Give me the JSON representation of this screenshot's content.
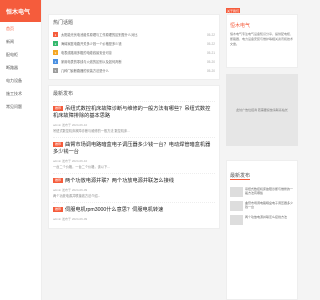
{
  "brand": "恒木电气",
  "nav": [
    "首页",
    "新闻",
    "配电柜",
    "断路器",
    "电力设备",
    "施工技术",
    "常见问题"
  ],
  "hot": {
    "title": "热门话题",
    "items": [
      {
        "text": "太阳能光伏电池组件原理与工作原理的区别是什么对比",
        "date": "05-22"
      },
      {
        "text": "海绵家庭电路开关多少钱一个价格是多少钱",
        "date": "05-22"
      },
      {
        "text": "电表线路用多粗的电缆线最安全可靠",
        "date": "05-21"
      },
      {
        "text": "家用电表的零线与火线的区别以及如何判断",
        "date": "05-20"
      },
      {
        "text": "几种门窗断路器的安装方法是什么",
        "date": "05-20"
      }
    ]
  },
  "latest": {
    "title": "最新发布",
    "articles": [
      {
        "tag": "推荐",
        "title": "吊纽式数控机床故障诊断与维修的一般方法有哪些？吊纽式数控机床故障排除的基本思路",
        "meta": "admin 发布于 2024-06-10",
        "desc": "吊纽式数控机床故障诊断与维修的一般方法 数控机床..."
      },
      {
        "tag": "推荐",
        "title": "曲臂市场调电路暗盒电子调压器多少钱一台？电动焊管暗盒机器多少钱一台",
        "meta": "admin 发布于 2024-06-10",
        "desc": "一台二个价格，一台二个价格，该以下..."
      },
      {
        "tag": "推荐",
        "title": "两个功放电源并联？两个功放电源并联怎么接线",
        "meta": "admin 发布于 2024-06-09",
        "desc": "两个功放电源并联接线方法介绍..."
      },
      {
        "tag": "推荐",
        "title": "伺服电机rpm3000什么意思？伺服电机转速",
        "meta": "admin 发布于 2024-06-09",
        "desc": ""
      }
    ]
  },
  "right": {
    "badge": "关于我们",
    "title": "恒木电气",
    "text": "恒木电气专注电气设备知识分享，提供配电柜、断路器、电力设备安装与维护等相关资讯和技术文章。",
    "ad": "此处广告位招商 若需要投放请联系站长",
    "list_title": "最新发布",
    "list": [
      {
        "text": "吊纽式数控机床故障诊断与维修的一般方法有哪些"
      },
      {
        "text": "曲臂市场调电路暗盒电子调压器多少钱一台"
      },
      {
        "text": "两个功放电源并联怎么接线方法"
      }
    ]
  }
}
